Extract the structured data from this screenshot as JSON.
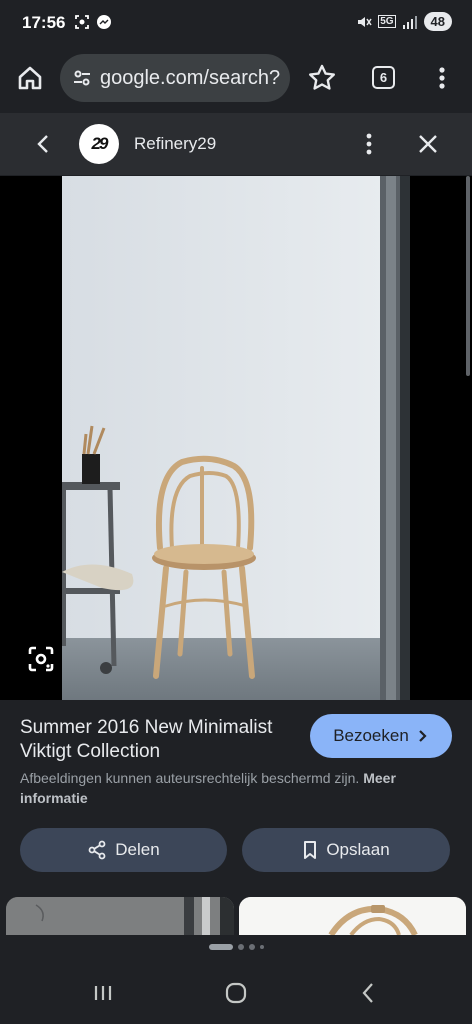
{
  "status": {
    "time": "17:56",
    "battery": "48",
    "network": "5G"
  },
  "browser": {
    "url": "google.com/search?",
    "tab_count": "6"
  },
  "source": {
    "logo_text": "29",
    "name": "Refinery29"
  },
  "result": {
    "title": "Summer 2016 New Minimalist Viktigt Collection",
    "visit_label": "Bezoeken",
    "copyright_text": "Afbeeldingen kunnen auteursrechtelijk beschermd zijn.",
    "more_info": "Meer informatie"
  },
  "actions": {
    "share_label": "Delen",
    "save_label": "Opslaan"
  },
  "icons": [
    "home-icon",
    "tune-icon",
    "star-icon",
    "tabs-icon",
    "more-vert-icon",
    "chevron-left-icon",
    "close-icon",
    "lens-icon",
    "chevron-right-icon",
    "share-icon",
    "bookmark-icon",
    "recents-icon",
    "home-nav-icon",
    "back-nav-icon"
  ],
  "colors": {
    "background": "#1f2125",
    "accent": "#8ab4f8",
    "action_button": "#3c4658"
  }
}
